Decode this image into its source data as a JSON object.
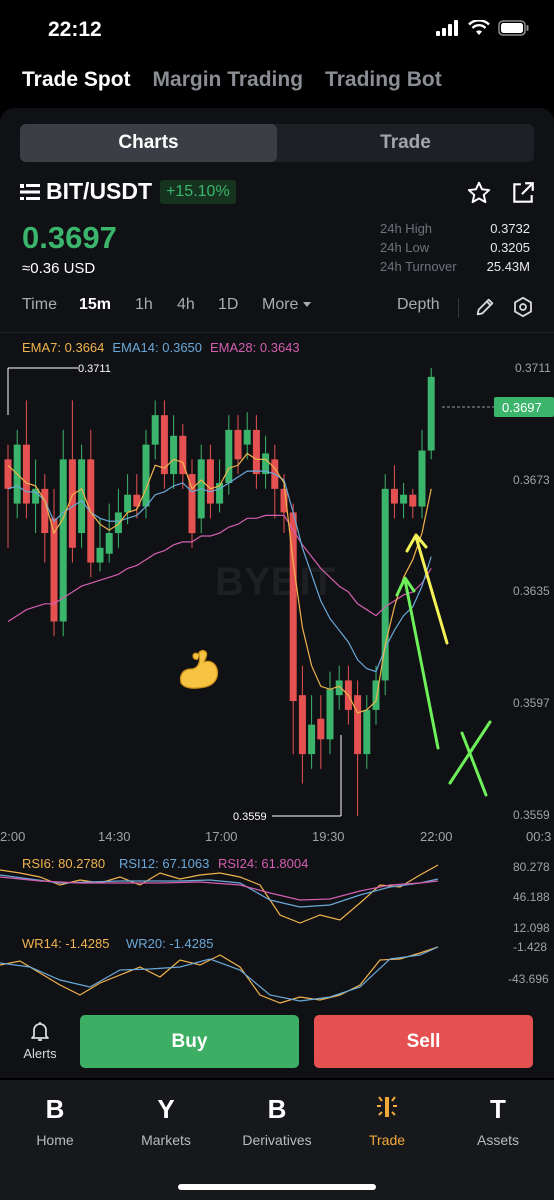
{
  "status": {
    "time": "22:12"
  },
  "top_tabs": [
    {
      "label": "Trade Spot",
      "active": true
    },
    {
      "label": "Margin Trading",
      "active": false
    },
    {
      "label": "Trading Bot",
      "active": false
    }
  ],
  "segments": [
    {
      "label": "Charts",
      "active": true
    },
    {
      "label": "Trade",
      "active": false
    }
  ],
  "pair": {
    "name": "BIT/USDT",
    "change": "+15.10%",
    "last_price": "0.3697",
    "usd_price": "≈0.36 USD",
    "stats": [
      {
        "label": "24h High",
        "value": "0.3732"
      },
      {
        "label": "24h Low",
        "value": "0.3205"
      },
      {
        "label": "24h Turnover",
        "value": "25.43M"
      }
    ]
  },
  "intervals": [
    {
      "label": "Time",
      "active": false
    },
    {
      "label": "15m",
      "active": true
    },
    {
      "label": "1h",
      "active": false
    },
    {
      "label": "4h",
      "active": false
    },
    {
      "label": "1D",
      "active": false
    },
    {
      "label": "More",
      "active": false
    }
  ],
  "depth_label": "Depth",
  "ema_legend": {
    "ema7": "EMA7: 0.3664",
    "ema14": "EMA14: 0.3650",
    "ema28": "EMA28: 0.3643"
  },
  "price_axis": [
    "0.3711",
    "0.3673",
    "0.3635",
    "0.3597",
    "0.3559"
  ],
  "price_tag": "0.3697",
  "high_marker": "0.3711",
  "low_marker": "0.3559",
  "watermark": "BYBIT",
  "time_axis": [
    "2:00",
    "14:30",
    "17:00",
    "19:30",
    "22:00",
    "00:3"
  ],
  "rsi_legend": {
    "rsi6": "RSI6: 80.2780",
    "rsi12": "RSI12: 67.1063",
    "rsi24": "RSI24: 61.8004"
  },
  "rsi_axis": [
    "80.278",
    "46.188",
    "12.098"
  ],
  "wr_legend": {
    "wr14": "WR14: -1.4285",
    "wr20": "WR20: -1.4285"
  },
  "wr_axis": [
    "-1.428",
    "-43.696"
  ],
  "colors": {
    "up": "#3bb56c",
    "down": "#e55151",
    "ema7": "#f0b34d",
    "ema14": "#6aa8d8",
    "ema28": "#d35fb0"
  },
  "actions": {
    "alerts": "Alerts",
    "buy": "Buy",
    "sell": "Sell"
  },
  "nav": [
    {
      "glyph": "B",
      "label": "Home",
      "icon": "home-icon",
      "active": false
    },
    {
      "glyph": "Y",
      "label": "Markets",
      "icon": "markets-icon",
      "active": false
    },
    {
      "glyph": "B",
      "label": "Derivatives",
      "icon": "derivatives-icon",
      "active": false
    },
    {
      "glyph": "",
      "label": "Trade",
      "icon": "trade-icon",
      "active": true
    },
    {
      "glyph": "T",
      "label": "Assets",
      "icon": "assets-icon",
      "active": false
    }
  ],
  "candles": [
    {
      "o": 0.368,
      "c": 0.367,
      "h": 0.3685,
      "l": 0.365
    },
    {
      "o": 0.3665,
      "c": 0.3685,
      "h": 0.369,
      "l": 0.366
    },
    {
      "o": 0.3685,
      "c": 0.3665,
      "h": 0.37,
      "l": 0.366
    },
    {
      "o": 0.3665,
      "c": 0.367,
      "h": 0.368,
      "l": 0.3655
    },
    {
      "o": 0.367,
      "c": 0.3655,
      "h": 0.3675,
      "l": 0.3645
    },
    {
      "o": 0.366,
      "c": 0.3625,
      "h": 0.367,
      "l": 0.362
    },
    {
      "o": 0.3625,
      "c": 0.368,
      "h": 0.369,
      "l": 0.362
    },
    {
      "o": 0.368,
      "c": 0.365,
      "h": 0.37,
      "l": 0.3645
    },
    {
      "o": 0.3655,
      "c": 0.368,
      "h": 0.3685,
      "l": 0.365
    },
    {
      "o": 0.368,
      "c": 0.3645,
      "h": 0.369,
      "l": 0.364
    },
    {
      "o": 0.3645,
      "c": 0.365,
      "h": 0.366,
      "l": 0.3642
    },
    {
      "o": 0.3648,
      "c": 0.3655,
      "h": 0.3665,
      "l": 0.3645
    },
    {
      "o": 0.3655,
      "c": 0.3662,
      "h": 0.367,
      "l": 0.365
    },
    {
      "o": 0.3662,
      "c": 0.3668,
      "h": 0.3675,
      "l": 0.3658
    },
    {
      "o": 0.3668,
      "c": 0.3664,
      "h": 0.3675,
      "l": 0.366
    },
    {
      "o": 0.3664,
      "c": 0.3685,
      "h": 0.369,
      "l": 0.366
    },
    {
      "o": 0.3685,
      "c": 0.3695,
      "h": 0.37,
      "l": 0.368
    },
    {
      "o": 0.3695,
      "c": 0.3675,
      "h": 0.37,
      "l": 0.367
    },
    {
      "o": 0.3675,
      "c": 0.3688,
      "h": 0.3695,
      "l": 0.367
    },
    {
      "o": 0.3688,
      "c": 0.3675,
      "h": 0.3692,
      "l": 0.367
    },
    {
      "o": 0.3675,
      "c": 0.3655,
      "h": 0.368,
      "l": 0.365
    },
    {
      "o": 0.366,
      "c": 0.368,
      "h": 0.3685,
      "l": 0.3655
    },
    {
      "o": 0.368,
      "c": 0.3665,
      "h": 0.3685,
      "l": 0.366
    },
    {
      "o": 0.3665,
      "c": 0.3672,
      "h": 0.368,
      "l": 0.3662
    },
    {
      "o": 0.3672,
      "c": 0.369,
      "h": 0.3695,
      "l": 0.3668
    },
    {
      "o": 0.369,
      "c": 0.368,
      "h": 0.3695,
      "l": 0.3675
    },
    {
      "o": 0.3685,
      "c": 0.369,
      "h": 0.3696,
      "l": 0.368
    },
    {
      "o": 0.369,
      "c": 0.3675,
      "h": 0.3695,
      "l": 0.367
    },
    {
      "o": 0.3675,
      "c": 0.3682,
      "h": 0.3688,
      "l": 0.367
    },
    {
      "o": 0.368,
      "c": 0.367,
      "h": 0.3685,
      "l": 0.366
    },
    {
      "o": 0.367,
      "c": 0.3662,
      "h": 0.3675,
      "l": 0.3655
    },
    {
      "o": 0.3662,
      "c": 0.3598,
      "h": 0.3665,
      "l": 0.358
    },
    {
      "o": 0.36,
      "c": 0.358,
      "h": 0.361,
      "l": 0.357
    },
    {
      "o": 0.358,
      "c": 0.359,
      "h": 0.36,
      "l": 0.3575
    },
    {
      "o": 0.3592,
      "c": 0.3585,
      "h": 0.36,
      "l": 0.3575
    },
    {
      "o": 0.3585,
      "c": 0.3602,
      "h": 0.3608,
      "l": 0.358
    },
    {
      "o": 0.36,
      "c": 0.3605,
      "h": 0.361,
      "l": 0.3595
    },
    {
      "o": 0.3605,
      "c": 0.3595,
      "h": 0.361,
      "l": 0.359
    },
    {
      "o": 0.36,
      "c": 0.358,
      "h": 0.3605,
      "l": 0.3559
    },
    {
      "o": 0.358,
      "c": 0.3595,
      "h": 0.36,
      "l": 0.3575
    },
    {
      "o": 0.3595,
      "c": 0.3605,
      "h": 0.361,
      "l": 0.359
    },
    {
      "o": 0.3605,
      "c": 0.367,
      "h": 0.3675,
      "l": 0.36
    },
    {
      "o": 0.367,
      "c": 0.3665,
      "h": 0.3678,
      "l": 0.366
    },
    {
      "o": 0.3665,
      "c": 0.3668,
      "h": 0.3672,
      "l": 0.366
    },
    {
      "o": 0.3668,
      "c": 0.3664,
      "h": 0.367,
      "l": 0.366
    },
    {
      "o": 0.3664,
      "c": 0.3683,
      "h": 0.369,
      "l": 0.366
    },
    {
      "o": 0.3683,
      "c": 0.3708,
      "h": 0.3711,
      "l": 0.368
    }
  ],
  "ema7_series": [
    0.3678,
    0.3675,
    0.3672,
    0.3671,
    0.3666,
    0.3655,
    0.366,
    0.3668,
    0.367,
    0.3662,
    0.3658,
    0.3656,
    0.3658,
    0.3662,
    0.3663,
    0.367,
    0.3678,
    0.3677,
    0.368,
    0.3679,
    0.367,
    0.3673,
    0.367,
    0.3671,
    0.3677,
    0.3678,
    0.3682,
    0.368,
    0.368,
    0.3677,
    0.3672,
    0.3645,
    0.3623,
    0.361,
    0.3603,
    0.3602,
    0.3603,
    0.36,
    0.3594,
    0.3595,
    0.3598,
    0.3617,
    0.363,
    0.364,
    0.3646,
    0.3655,
    0.367
  ],
  "ema14_series": [
    0.367,
    0.3671,
    0.3669,
    0.3669,
    0.3666,
    0.3659,
    0.3662,
    0.3664,
    0.3666,
    0.3662,
    0.366,
    0.3659,
    0.3659,
    0.366,
    0.3661,
    0.3664,
    0.3668,
    0.3669,
    0.3671,
    0.3672,
    0.3669,
    0.367,
    0.3669,
    0.367,
    0.3672,
    0.3674,
    0.3676,
    0.3676,
    0.3676,
    0.3675,
    0.3673,
    0.3662,
    0.365,
    0.3641,
    0.3632,
    0.3626,
    0.3622,
    0.3618,
    0.3612,
    0.3609,
    0.3608,
    0.3616,
    0.3622,
    0.3627,
    0.363,
    0.3637,
    0.3647
  ],
  "ema28_series": [
    0.3625,
    0.3627,
    0.3629,
    0.363,
    0.3631,
    0.3631,
    0.3633,
    0.3635,
    0.3637,
    0.3638,
    0.3639,
    0.364,
    0.3641,
    0.3643,
    0.3644,
    0.3646,
    0.3648,
    0.3649,
    0.3651,
    0.3652,
    0.3652,
    0.3654,
    0.3654,
    0.3655,
    0.3657,
    0.3658,
    0.366,
    0.366,
    0.3661,
    0.3661,
    0.3661,
    0.3656,
    0.3651,
    0.3647,
    0.3643,
    0.364,
    0.3637,
    0.3635,
    0.3631,
    0.3629,
    0.3627,
    0.363,
    0.3632,
    0.3634,
    0.3635,
    0.3638,
    0.3643
  ]
}
